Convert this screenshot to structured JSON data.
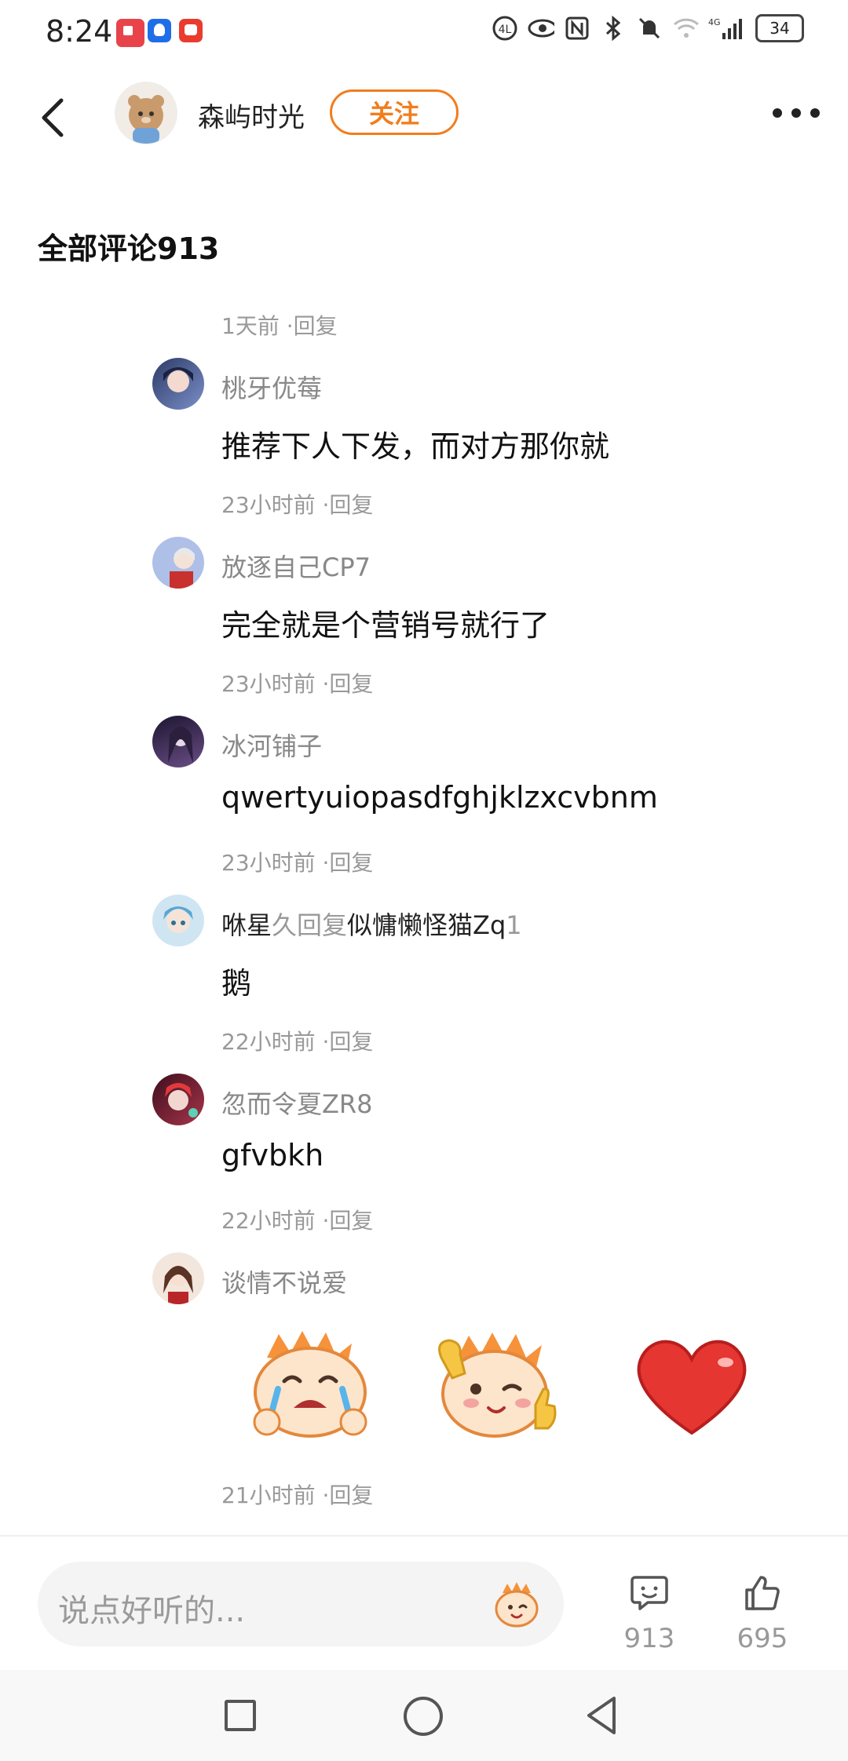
{
  "status_bar": {
    "time": "8:24",
    "battery": "34",
    "notification_icons": [
      "red-book-icon",
      "blue-bulb-icon",
      "red-app-icon"
    ],
    "right_icons": [
      "hd-icon",
      "eye-icon",
      "nfc-icon",
      "bluetooth-icon",
      "mute-icon",
      "wifi-icon",
      "4g-signal-icon"
    ]
  },
  "header": {
    "author_name": "森屿时光",
    "follow_label": "关注"
  },
  "section_title": "全部评论913",
  "first_meta": "1天前 ·回复",
  "comments": [
    {
      "user": "桃牙优莓",
      "text": "推荐下人下发，而对方那你就",
      "meta": "23小时前 ·回复"
    },
    {
      "user": "放逐自己CP7",
      "text": "完全就是个营销号就行了",
      "meta": "23小时前 ·回复"
    },
    {
      "user": "冰河铺子",
      "text": "qwertyuiopasdfghjklzxcvbnm",
      "meta": "23小时前 ·回复"
    },
    {
      "reply_from": "咻星",
      "reply_from_tail": "久",
      "reply_word": "回复",
      "reply_to": "似慵懒怪猫Zq",
      "reply_to_tail": "1",
      "text": "鹅",
      "meta": "22小时前 ·回复"
    },
    {
      "user": "忽而令夏ZR8",
      "text": "gfvbkh",
      "meta": "22小时前 ·回复"
    },
    {
      "user": "谈情不说爱",
      "meta": "21小时前 ·回复",
      "stickers": [
        "crying-mascot-sticker",
        "wink-thumbs-up-mascot-sticker",
        "red-heart-sticker"
      ]
    }
  ],
  "bottom_bar": {
    "input_placeholder": "说点好听的...",
    "comment_count": "913",
    "like_count": "695"
  },
  "colors": {
    "accent": "#f27d1d",
    "meta_gray": "#999999"
  }
}
